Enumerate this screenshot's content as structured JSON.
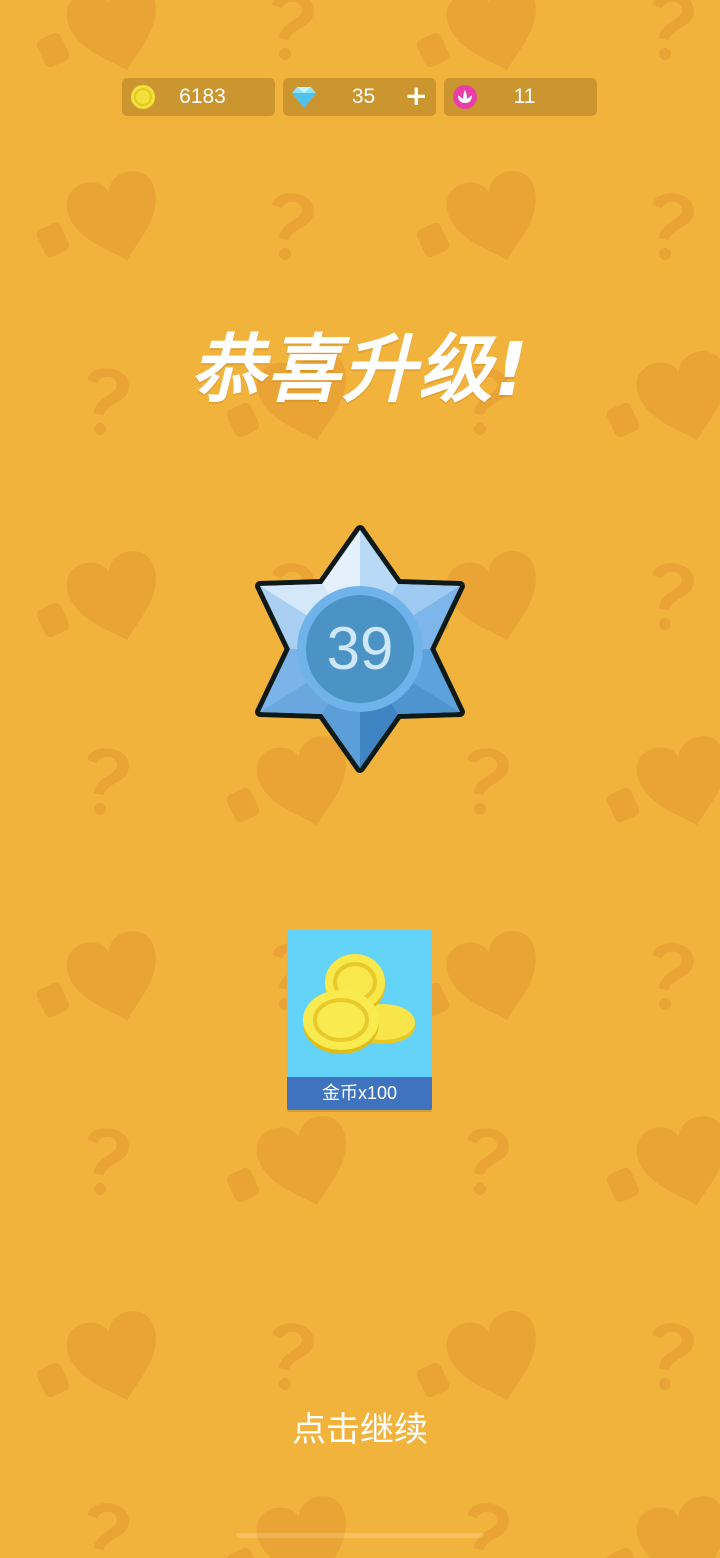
{
  "currencies": {
    "coins": {
      "value": "6183",
      "icon": "coin-icon"
    },
    "gems": {
      "value": "35",
      "icon": "diamond-icon",
      "add_label": "+"
    },
    "tickets": {
      "value": "11",
      "icon": "lotus-icon"
    }
  },
  "title": "恭喜升级!",
  "level": {
    "number": "39",
    "icon": "star-badge-icon"
  },
  "reward": {
    "label": "金币x100",
    "icon": "gold-coins-icon"
  },
  "continue_label": "点击继续",
  "colors": {
    "background": "#F2B33D",
    "pattern": "#EAA335",
    "badge_light": "#A8D4F6",
    "badge_dark": "#4A95CF",
    "reward_card": "#63D3F7",
    "reward_label_bar": "#3F73C0",
    "coin": "#F4E03A"
  }
}
